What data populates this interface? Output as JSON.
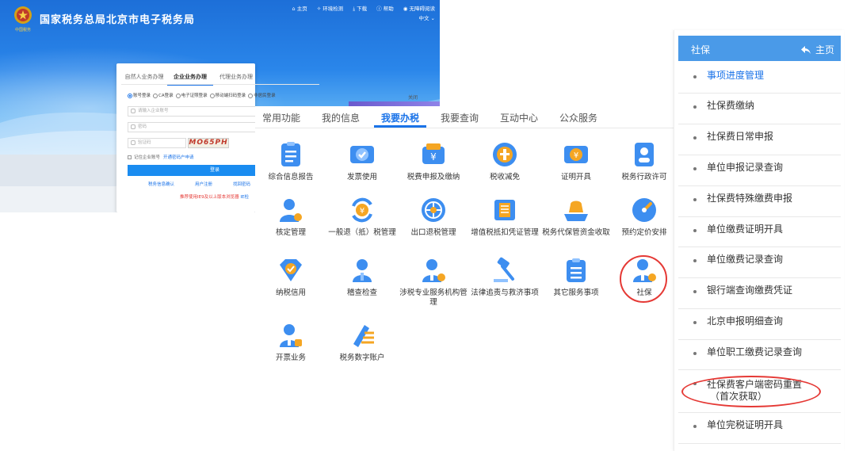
{
  "portal": {
    "site_title": "国家税务总局北京市电子税务局",
    "emblem_caption": "中国税务",
    "topnav": [
      "主页",
      "环境检测",
      "下载",
      "帮助",
      "无障碍阅读"
    ],
    "lang": "中文",
    "login": {
      "tabs": [
        "自然人业务办理",
        "企业业务办理",
        "代理业务办理"
      ],
      "active_tab": 1,
      "modes": [
        "账号登录",
        "CA登录",
        "电子证照登录",
        "移动端扫码登录",
        "非居民登录"
      ],
      "account_placeholder": "请输入企业账号",
      "password_placeholder": "密码",
      "captcha_placeholder": "验证码",
      "captcha_text": "MO65PH",
      "remember_label": "记住企业账号",
      "register_link": "开通密码户申请",
      "login_button": "登录",
      "links": [
        "税务信息确认",
        "用户注册",
        "找回密码"
      ],
      "browser_warning": "推荐使用IE9及以上版本浏览器",
      "browser_warning_link": "IE检",
      "side_label": "关闭"
    }
  },
  "main": {
    "tabs": [
      "常用功能",
      "我的信息",
      "我要办税",
      "我要查询",
      "互动中心",
      "公众服务"
    ],
    "active_tab": 2,
    "items": [
      {
        "label": "综合信息报告",
        "icon": "document-list-icon"
      },
      {
        "label": "发票使用",
        "icon": "invoice-icon"
      },
      {
        "label": "税费申报及缴纳",
        "icon": "tax-payment-icon"
      },
      {
        "label": "税收减免",
        "icon": "tax-reduction-icon"
      },
      {
        "label": "证明开具",
        "icon": "certificate-icon"
      },
      {
        "label": "税务行政许可",
        "icon": "admin-license-icon"
      },
      {
        "label": "核定管理",
        "icon": "verification-management-icon"
      },
      {
        "label": "一般退（抵）税管理",
        "icon": "tax-refund-icon"
      },
      {
        "label": "出口退税管理",
        "icon": "export-refund-icon"
      },
      {
        "label": "增值税抵扣凭证管理",
        "icon": "vat-voucher-icon"
      },
      {
        "label": "税务代保管资金收取",
        "icon": "custody-fund-icon"
      },
      {
        "label": "预约定价安排",
        "icon": "advance-pricing-icon"
      },
      {
        "label": "纳税信用",
        "icon": "tax-credit-icon"
      },
      {
        "label": "稽查检查",
        "icon": "inspection-icon"
      },
      {
        "label": "涉税专业服务机构管理",
        "icon": "service-agency-icon"
      },
      {
        "label": "法律追责与救济事项",
        "icon": "legal-hammer-icon"
      },
      {
        "label": "其它服务事项",
        "icon": "other-services-icon"
      },
      {
        "label": "社保",
        "icon": "social-security-icon"
      },
      {
        "label": "开票业务",
        "icon": "invoicing-business-icon"
      },
      {
        "label": "税务数字账户",
        "icon": "digital-account-icon"
      }
    ]
  },
  "sidebar": {
    "title": "社保",
    "home_label": "主页",
    "items": [
      {
        "label": "事项进度管理"
      },
      {
        "label": "社保费缴纳"
      },
      {
        "label": "社保费日常申报"
      },
      {
        "label": "单位申报记录查询"
      },
      {
        "label": "社保费特殊缴费申报"
      },
      {
        "label": "单位缴费证明开具"
      },
      {
        "label": "单位缴费记录查询"
      },
      {
        "label": "银行端查询缴费凭证"
      },
      {
        "label": "北京申报明细查询"
      },
      {
        "label": "单位职工缴费记录查询"
      },
      {
        "label": "社保费客户端密码重置",
        "label2": "（首次获取）"
      },
      {
        "label": "单位完税证明开具"
      }
    ],
    "active_item": 0
  },
  "colors": {
    "accent": "#1a73e8",
    "sidebar_header": "#4a9ae8",
    "annotation_red": "#e53935",
    "icon_blue": "#3d8ef0",
    "icon_orange": "#f5a623"
  }
}
